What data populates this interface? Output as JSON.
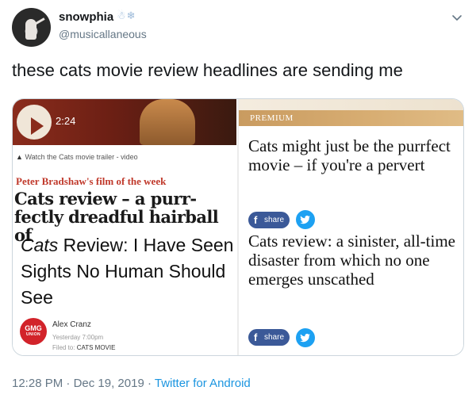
{
  "tweet": {
    "display_name": "snowphia",
    "name_emoji": "☃❄",
    "handle": "@musicallaneous",
    "text": "these cats movie review headlines are sending me",
    "time": "12:28 PM",
    "date": "Dec 19, 2019",
    "source": "Twitter for Android"
  },
  "media": {
    "left": {
      "video_duration": "2:24",
      "video_caption": "Watch the Cats movie trailer - video",
      "kicker": "Peter Bradshaw's film of the week",
      "guardian_headline": "Cats review – a purr-fectly dreadful hairball of",
      "verge_headline_italic": "Cats",
      "verge_headline_rest": " Review: I Have Seen Sights No Human Should See",
      "badge_line1": "GMG",
      "badge_line2": "UNION",
      "author": "Alex Cranz",
      "post_time": "Yesterday 7:00pm",
      "filed_label": "Filed to:",
      "filed_value": "CATS MOVIE"
    },
    "right": {
      "premium_label": "PREMIUM",
      "headline_1": "Cats might just be the purrfect movie – if you're a pervert",
      "headline_2": "Cats review: a sinister, all-time disaster from which no one emerges unscathed",
      "share_label": "share"
    }
  },
  "colors": {
    "twitter_blue": "#1da1f2",
    "link_blue": "#1b95e0",
    "facebook_blue": "#3b5998",
    "guardian_red": "#c0392b",
    "premium_gold": "#d8ae73"
  }
}
